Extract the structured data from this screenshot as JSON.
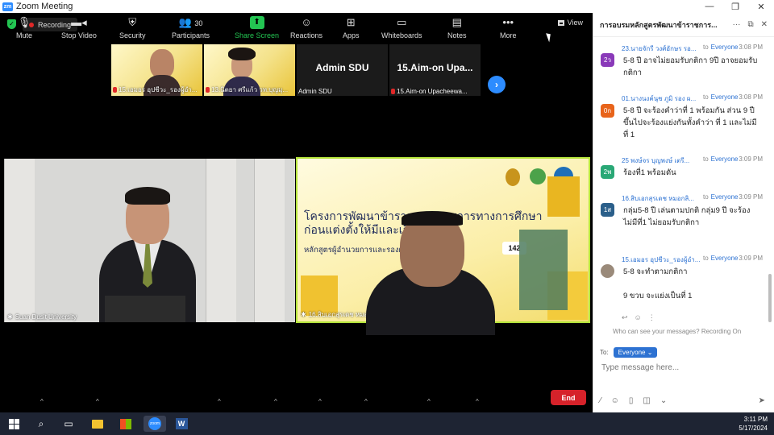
{
  "window": {
    "title": "Zoom Meeting",
    "logo": "zm"
  },
  "topbar": {
    "recording_label": "Recording",
    "view_label": "View"
  },
  "thumbnails": [
    {
      "kind": "slide",
      "name": "15.เอมอร อุปชีวะ_รองผู้อำ..."
    },
    {
      "kind": "slide",
      "name": "13.นิตยา ศรีแก้ว วท.บุญมุ..."
    },
    {
      "kind": "dark",
      "bigname": "Admin SDU",
      "name": "Admin SDU"
    },
    {
      "kind": "dark",
      "bigname": "15.Aim-on Upa...",
      "name": "15.Aim-on Upacheewa..."
    }
  ],
  "main_tiles": {
    "left_name": "Suan Dusit University",
    "right_name": "16.สิบเอกสุรเดช หมอกลิงข์ วิทยาลัยเทคนิคเกษตรวิสัย",
    "slide_title_line1": "โครงการพัฒนาข้าราชการ                    ราชการทางการศึกษา",
    "slide_title_line2": "ก่อนแต่งตั้งให้มีและเลื่อน",
    "slide_subtitle": "หลักสูตรผู้อำนวยการและรองผู้อ                          พิเศษ ระยะที่",
    "slide_badge": "142"
  },
  "toolbar": {
    "items": [
      {
        "id": "mute",
        "label": "Mute",
        "icon": "🎤",
        "caret": true
      },
      {
        "id": "video",
        "label": "Stop Video",
        "icon": "📹",
        "caret": true
      },
      {
        "id": "security",
        "label": "Security",
        "icon": "🛡",
        "caret": false
      },
      {
        "id": "participants",
        "label": "Participants",
        "icon": "👥",
        "count": "30",
        "caret": true
      },
      {
        "id": "share",
        "label": "Share Screen",
        "icon": "⬆",
        "caret": true
      },
      {
        "id": "reactions",
        "label": "Reactions",
        "icon": "☺",
        "caret": true
      },
      {
        "id": "apps",
        "label": "Apps",
        "icon": "⊞",
        "caret": true
      },
      {
        "id": "whiteboards",
        "label": "Whiteboards",
        "icon": "▭",
        "caret": true
      },
      {
        "id": "notes",
        "label": "Notes",
        "icon": "▤",
        "caret": true
      },
      {
        "id": "more",
        "label": "More",
        "icon": "•••",
        "caret": false
      }
    ],
    "end_label": "End",
    "colors": {
      "share": "#23c552",
      "end": "#d6222a"
    }
  },
  "chat": {
    "title": "การอบรมหลักสูตรพัฒนาข้าราชการ...",
    "messages": [
      {
        "avatar": "2ว",
        "avatar_color": "#8a3ab9",
        "sender": "23.นายจักรี วงศ์อักษร รอ...",
        "to": "to",
        "recipient": "Everyone",
        "time": "3:08 PM",
        "text": "5-8 ปี อาจไม่ยอมรับกติกา 9ปี อาจยอมรับกติกา"
      },
      {
        "avatar": "0ก",
        "avatar_color": "#e8641b",
        "sender": "01.นางนงค์นุช ภูมิ รอง ผ...",
        "to": "to",
        "recipient": "Everyone",
        "time": "3:08 PM",
        "text": "5-8 ปี จะร้องคำว่าที่ 1 พร้อมกัน ส่วน 9 ปี ขึ้นไปจะร้องแย่งกันทั้งคำว่า ที่ 1 และไม่มีที่ 1"
      },
      {
        "avatar": "2พ",
        "avatar_color": "#2aa876",
        "sender": "25 พงษ์จร บุญพงษ์ เตรี...",
        "to": "to",
        "recipient": "Everyone",
        "time": "3:09 PM",
        "text": "ร้องที่1 พร้อมดัน"
      },
      {
        "avatar": "1ส",
        "avatar_color": "#2b5f8a",
        "sender": "16.สิบเอกสุรเดช หมอกลิ...",
        "to": "to",
        "recipient": "Everyone",
        "time": "3:09 PM",
        "text": "กลุ่ม5-8 ปี เล่นตามปกติ กลุ่ม9 ปี จะร้องไม่มีที่1 ไม่ยอมรับกติกา"
      },
      {
        "avatar": "",
        "avatar_color": "#9a8a7a",
        "sender": "15.เอมอร อุปชีวะ_รองผู้อำ...",
        "to": "to",
        "recipient": "Everyone",
        "time": "3:09 PM",
        "text": "5-8 จะทำตามกติกา",
        "text2": "9 ขวบ จะแย่งเป็นที่ 1"
      }
    ],
    "who_can_see": "Who can see your messages? Recording On",
    "to_label": "To:",
    "to_value": "Everyone",
    "input_placeholder": "Type message here..."
  },
  "taskbar": {
    "time": "3:11 PM",
    "date": "5/17/2024",
    "zoom_label": "zoom",
    "word_label": "W"
  }
}
